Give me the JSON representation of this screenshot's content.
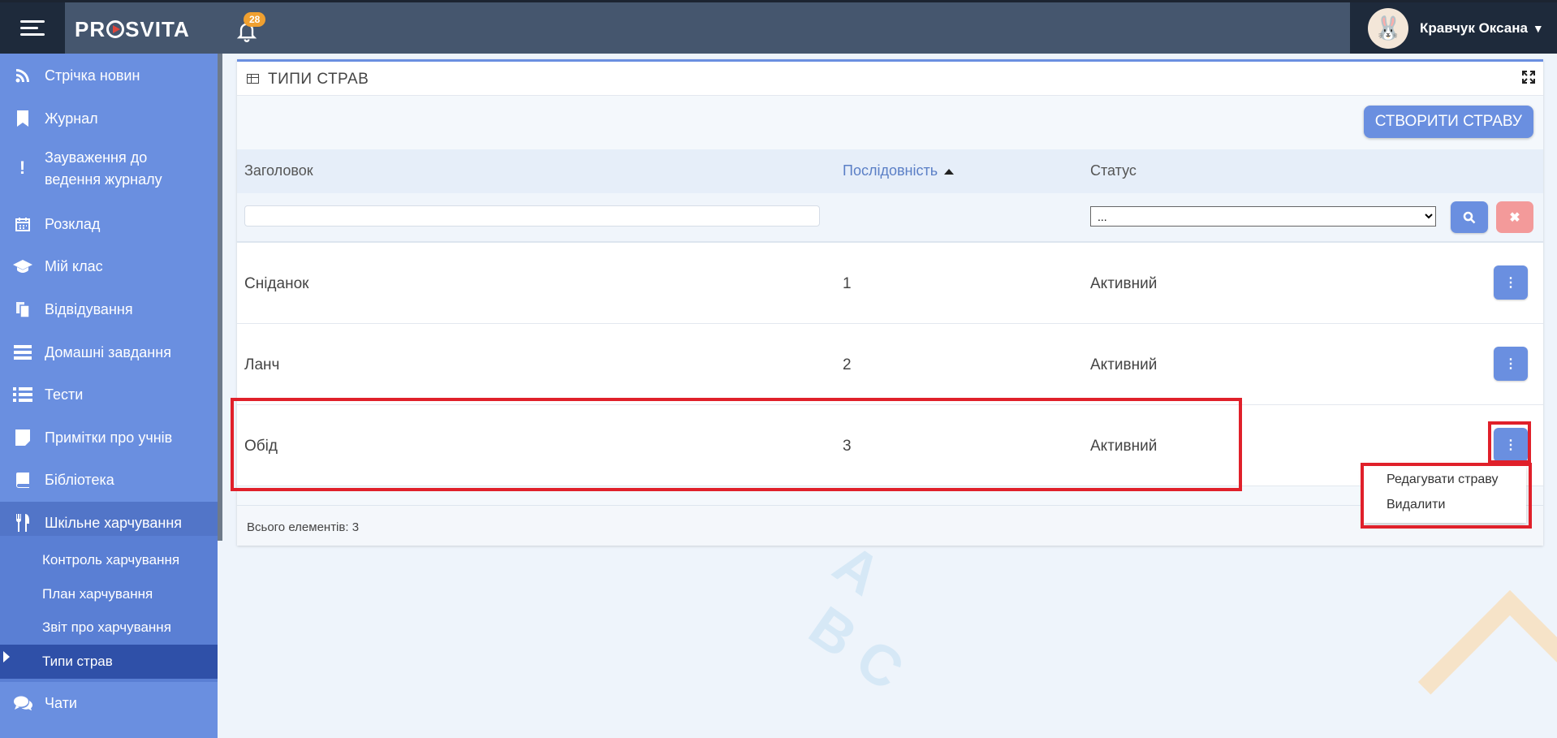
{
  "header": {
    "brand": "PROSVITA",
    "notification_count": "28",
    "user_name": "Кравчук Оксана"
  },
  "sidebar": {
    "items": [
      {
        "label": "Стрічка новин",
        "icon": "rss-icon"
      },
      {
        "label": "Журнал",
        "icon": "bookmark-icon"
      },
      {
        "label": "Зауваження до ведення журналу",
        "icon": "exclamation-icon"
      },
      {
        "label": "Розклад",
        "icon": "calendar-icon"
      },
      {
        "label": "Мій клас",
        "icon": "graduation-cap-icon"
      },
      {
        "label": "Відвідування",
        "icon": "copy-icon"
      },
      {
        "label": "Домашні завдання",
        "icon": "tasks-icon"
      },
      {
        "label": "Тести",
        "icon": "list-icon"
      },
      {
        "label": "Примітки про учнів",
        "icon": "note-icon"
      },
      {
        "label": "Бібліотека",
        "icon": "book-icon"
      },
      {
        "label": "Шкільне харчування",
        "icon": "utensils-icon"
      },
      {
        "label": "Чати",
        "icon": "chat-icon"
      }
    ],
    "sub_items": [
      {
        "label": "Контроль харчування"
      },
      {
        "label": "План харчування"
      },
      {
        "label": "Звіт про харчування"
      },
      {
        "label": "Типи страв"
      }
    ]
  },
  "panel": {
    "title": "ТИПИ СТРАВ",
    "create_button": "СТВОРИТИ СТРАВУ",
    "columns": [
      "Заголовок",
      "Послідовність",
      "Статус"
    ],
    "status_filter_value": "...",
    "rows": [
      {
        "title": "Сніданок",
        "sequence": "1",
        "status": "Активний"
      },
      {
        "title": "Ланч",
        "sequence": "2",
        "status": "Активний"
      },
      {
        "title": "Обід",
        "sequence": "3",
        "status": "Активний"
      }
    ],
    "footer": "Всього елементів: 3",
    "row_menu": [
      "Редагувати страву",
      "Видалити"
    ]
  },
  "colors": {
    "accent": "#6a8fe0",
    "topbar": "#45566e",
    "highlight": "#e0202a"
  }
}
